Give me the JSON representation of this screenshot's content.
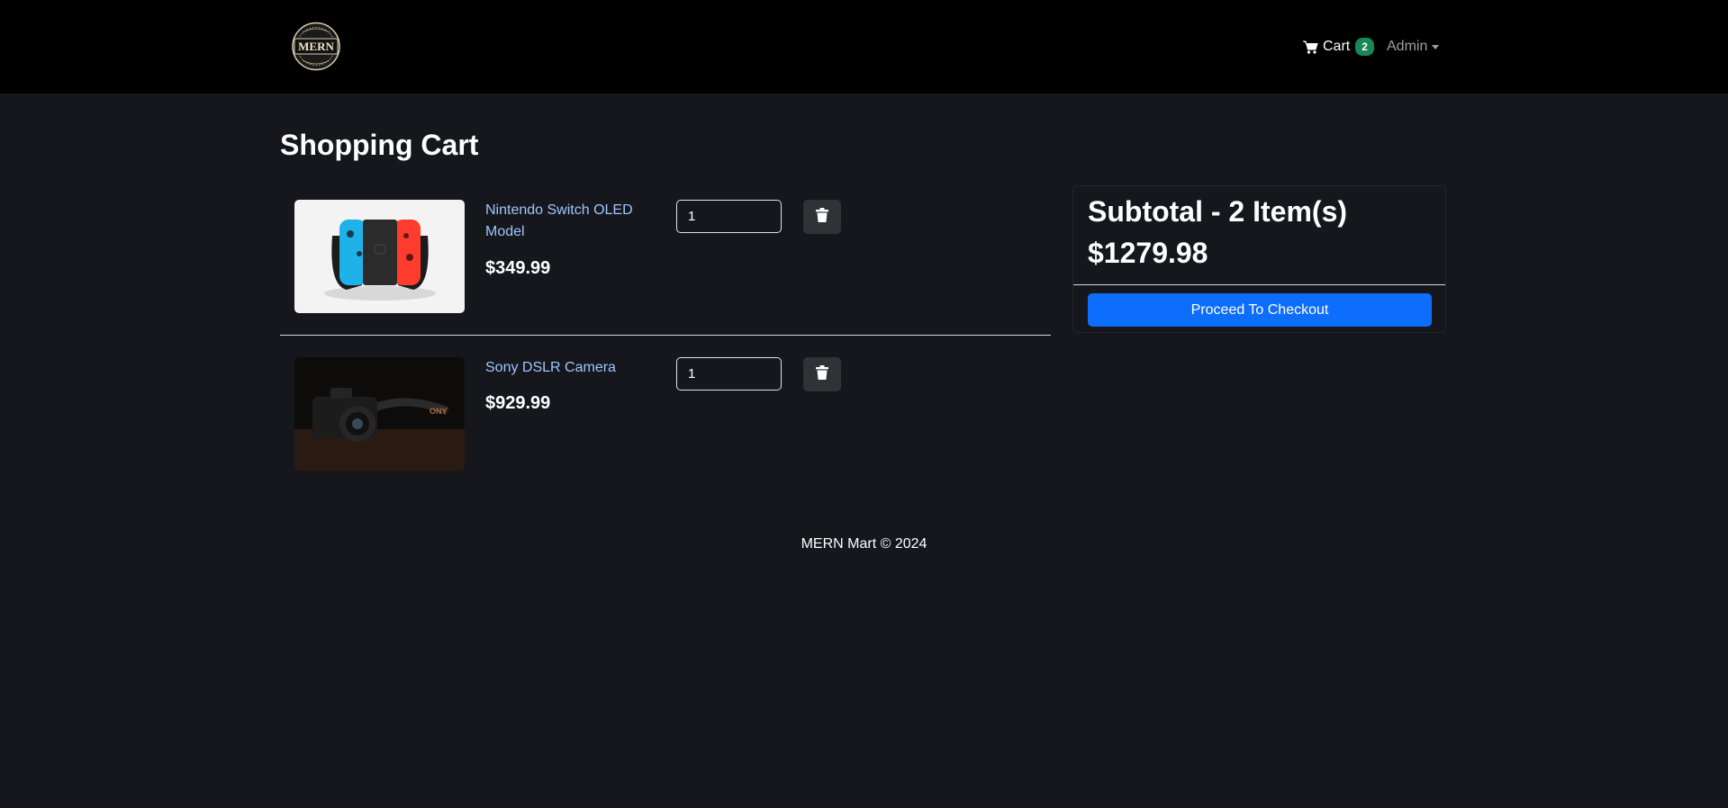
{
  "brand": {
    "logo_text": "MERN"
  },
  "nav": {
    "cart_label": "Cart",
    "cart_count": "2",
    "admin_label": "Admin"
  },
  "page": {
    "title": "Shopping Cart"
  },
  "items": [
    {
      "name": "Nintendo Switch OLED Model",
      "price": "$349.99",
      "quantity": "1"
    },
    {
      "name": "Sony DSLR Camera",
      "price": "$929.99",
      "quantity": "1"
    }
  ],
  "summary": {
    "title": "Subtotal - 2 Item(s)",
    "amount": "$1279.98",
    "checkout_label": "Proceed To Checkout"
  },
  "footer": {
    "text": "MERN Mart © 2024"
  },
  "colors": {
    "background": "#16171d",
    "navbar": "#000000",
    "primary": "#0d6efd",
    "badge": "#198754",
    "link": "#9ec5fe"
  }
}
